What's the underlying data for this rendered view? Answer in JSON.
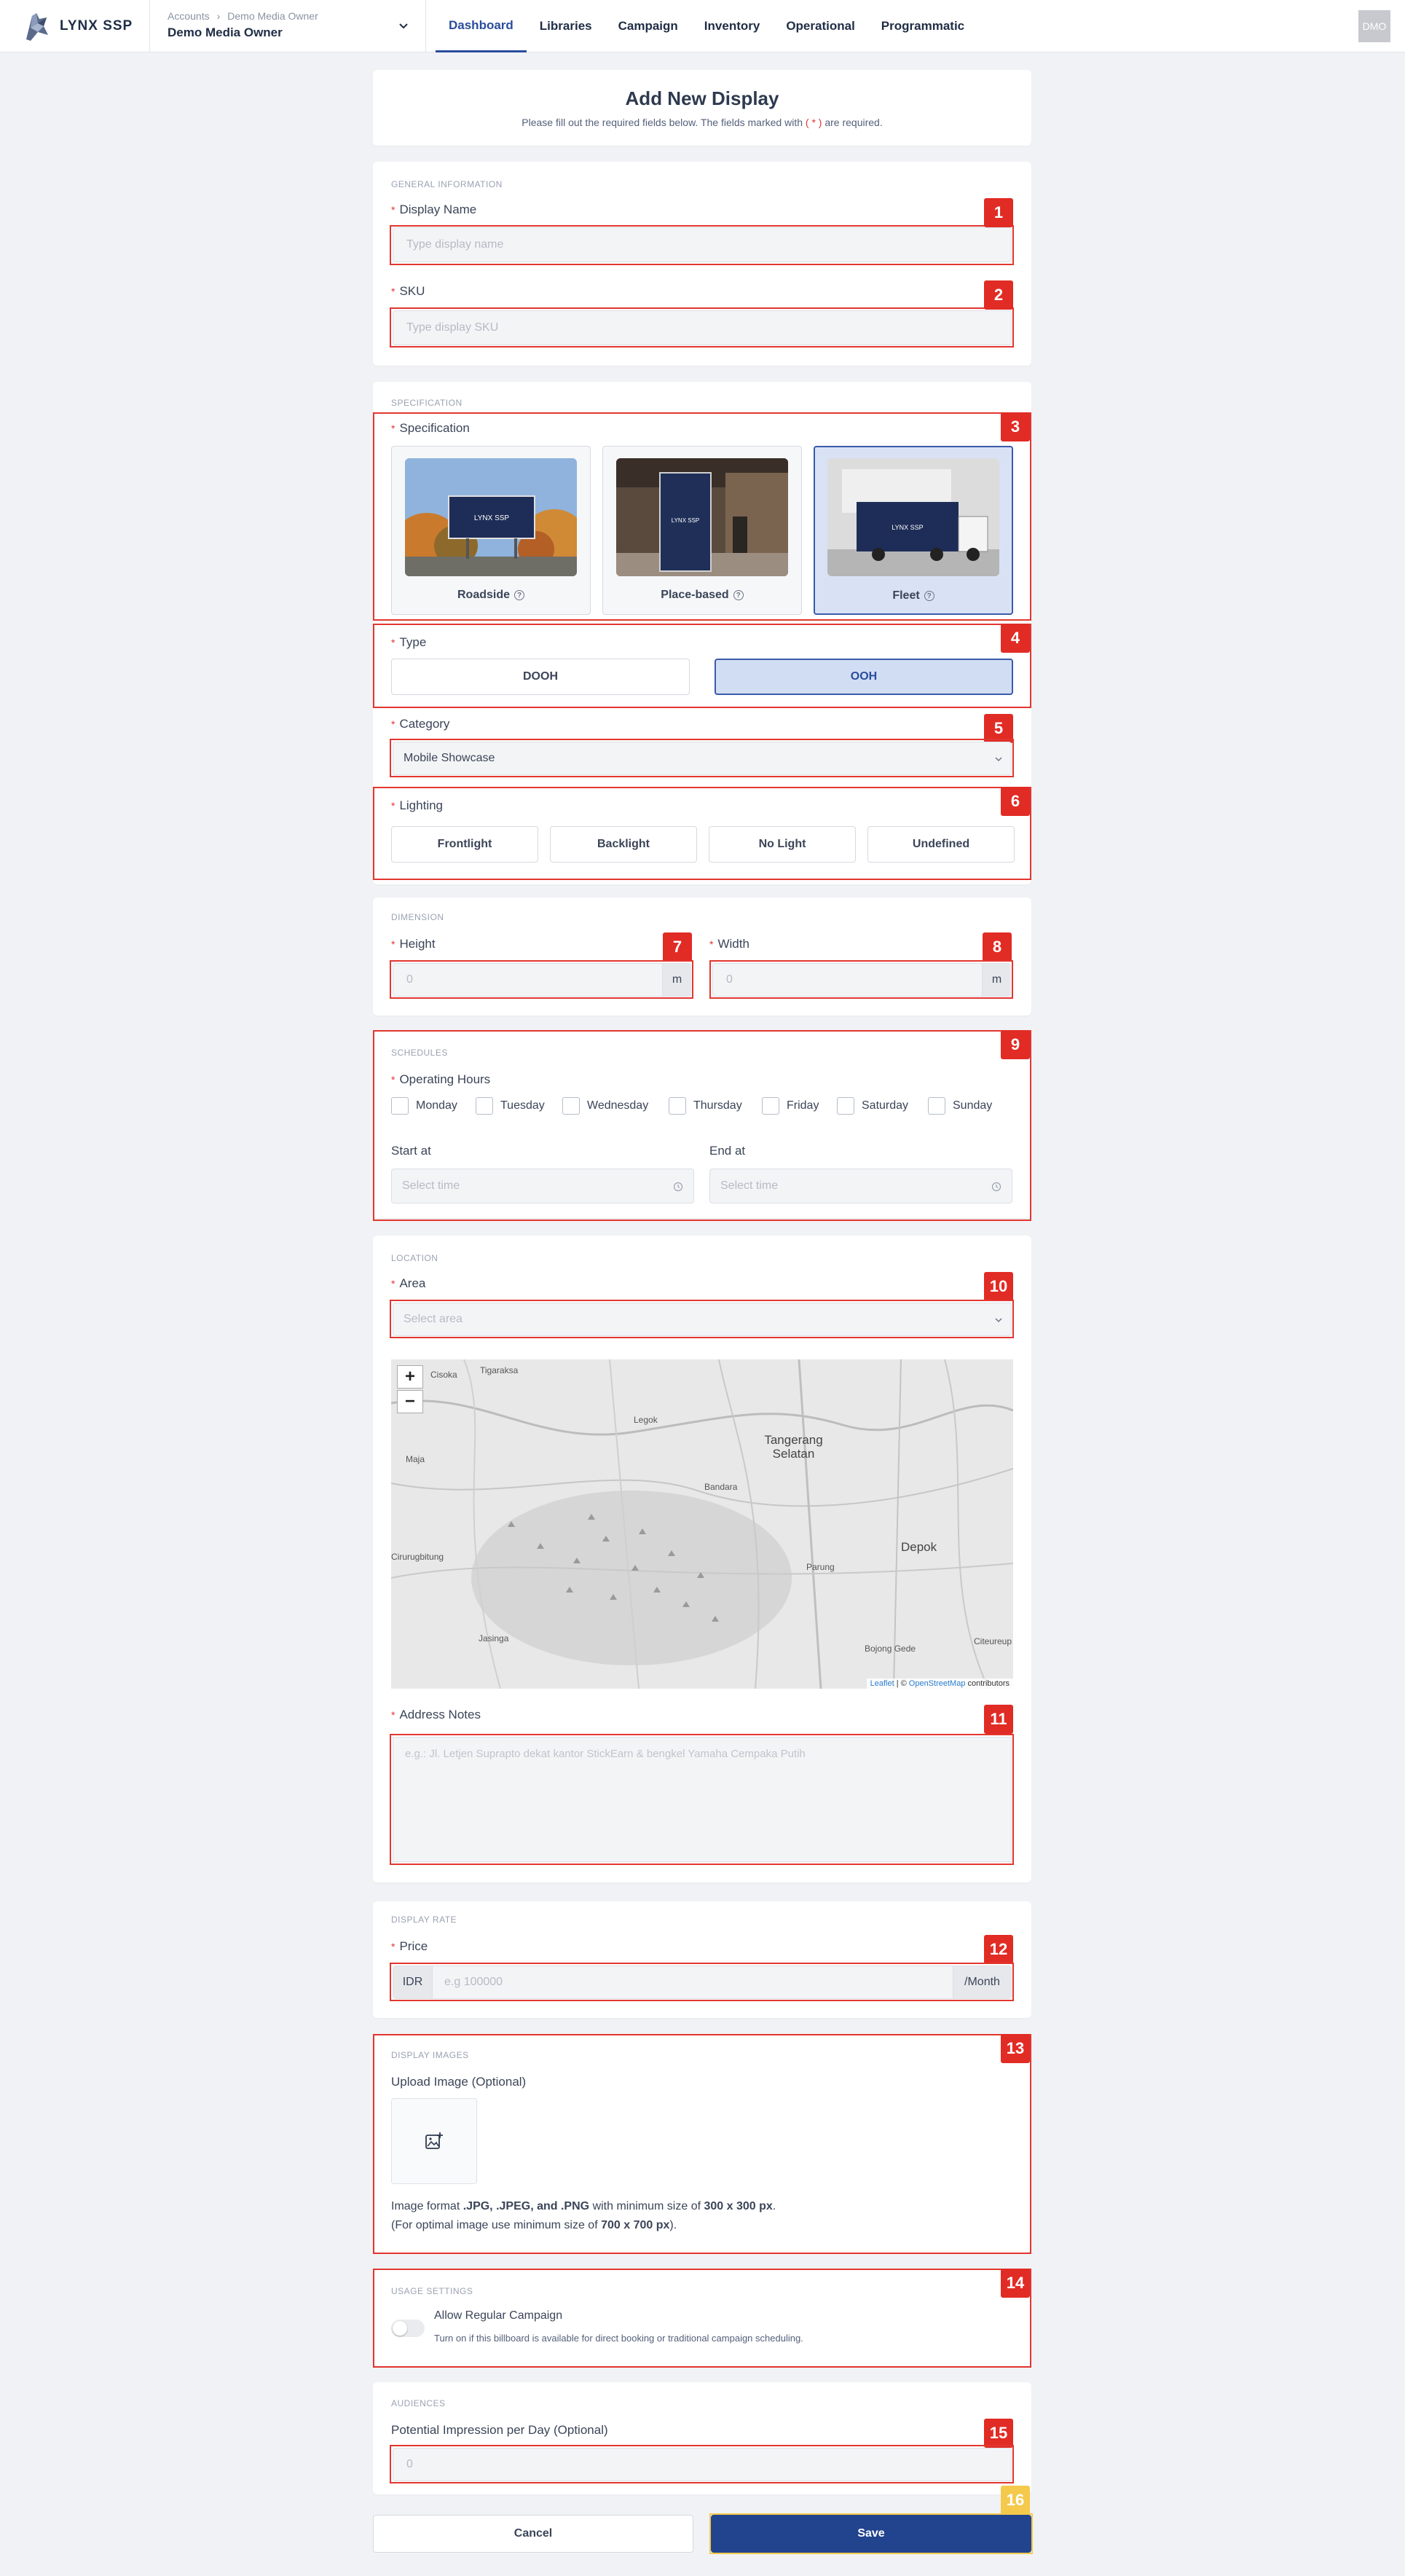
{
  "nav": {
    "logo_text": "LYNX SSP",
    "breadcrumb": [
      "Accounts",
      "Demo Media Owner"
    ],
    "account_name": "Demo Media Owner",
    "tabs": [
      "Dashboard",
      "Libraries",
      "Campaign",
      "Inventory",
      "Operational",
      "Programmatic"
    ],
    "active_tab": "Dashboard",
    "avatar": "DMO"
  },
  "header": {
    "title": "Add New Display",
    "subtitle_pre": "Please fill out the required fields below. The fields marked with",
    "subtitle_mark": "( * )",
    "subtitle_post": "are required."
  },
  "general": {
    "section": "GENERAL INFORMATION",
    "display_name_label": "Display Name",
    "display_name_placeholder": "Type display name",
    "sku_label": "SKU",
    "sku_placeholder": "Type display SKU"
  },
  "specification": {
    "section": "SPECIFICATION",
    "label": "Specification",
    "options": [
      "Roadside",
      "Place-based",
      "Fleet"
    ],
    "selected": "Fleet",
    "type_label": "Type",
    "types": [
      "DOOH",
      "OOH"
    ],
    "selected_type": "OOH",
    "category_label": "Category",
    "category_value": "Mobile Showcase",
    "lighting_label": "Lighting",
    "lighting_options": [
      "Frontlight",
      "Backlight",
      "No Light",
      "Undefined"
    ],
    "brand_on_screen": "LYNX SSP"
  },
  "dimension": {
    "section": "DIMENSION",
    "height_label": "Height",
    "height_placeholder": "0",
    "width_label": "Width",
    "width_placeholder": "0",
    "unit": "m"
  },
  "schedules": {
    "section": "SCHEDULES",
    "operating_label": "Operating Hours",
    "days": [
      "Monday",
      "Tuesday",
      "Wednesday",
      "Thursday",
      "Friday",
      "Saturday",
      "Sunday"
    ],
    "start_label": "Start at",
    "end_label": "End at",
    "time_placeholder": "Select time"
  },
  "location": {
    "section": "LOCATION",
    "area_label": "Area",
    "area_placeholder": "Select area",
    "map_places": [
      "Cisoka",
      "Tigaraksa",
      "Legok",
      "Tangerang Selatan",
      "Depok",
      "Cirurugbitung",
      "Jasinga",
      "Parung",
      "Bojong Gede",
      "Maja",
      "Citeureup",
      "Bandara"
    ],
    "attribution_leaflet": "Leaflet",
    "attribution_sep": "| ©",
    "attribution_osm": "OpenStreetMap",
    "attribution_tail": "contributors",
    "zoom_in": "+",
    "zoom_out": "−",
    "address_label": "Address Notes",
    "address_placeholder": "e.g.: Jl. Letjen Suprapto dekat kantor StickEarn & bengkel Yamaha Cempaka Putih"
  },
  "rate": {
    "section": "DISPLAY RATE",
    "price_label": "Price",
    "currency": "IDR",
    "price_placeholder": "e.g 100000",
    "period": "/Month"
  },
  "images": {
    "section": "DISPLAY IMAGES",
    "upload_label": "Upload Image (Optional)",
    "note1_pre": "Image format",
    "note1_formats": ".JPG, .JPEG, and .PNG",
    "note1_mid": "with minimum size of",
    "note1_size": "300 x 300 px",
    "note1_end": ".",
    "note2_pre": "(For optimal image use minimum size of",
    "note2_size": "700 x 700 px",
    "note2_end": ")."
  },
  "usage": {
    "section": "USAGE SETTINGS",
    "toggle_label": "Allow Regular Campaign",
    "toggle_desc": "Turn on if this billboard is available for direct booking or traditional campaign scheduling."
  },
  "audiences": {
    "section": "AUDIENCES",
    "impression_label": "Potential Impression per Day (Optional)",
    "impression_placeholder": "0"
  },
  "actions": {
    "cancel": "Cancel",
    "save": "Save"
  },
  "badges": [
    "1",
    "2",
    "3",
    "4",
    "5",
    "6",
    "7",
    "8",
    "9",
    "10",
    "11",
    "12",
    "13",
    "14",
    "15",
    "16"
  ],
  "colors": {
    "primary": "#22448e",
    "highlight": "#e2362f",
    "badge": "#e12b25",
    "badge_last": "#f4c94c",
    "selected_bg": "#d1ddf3"
  }
}
